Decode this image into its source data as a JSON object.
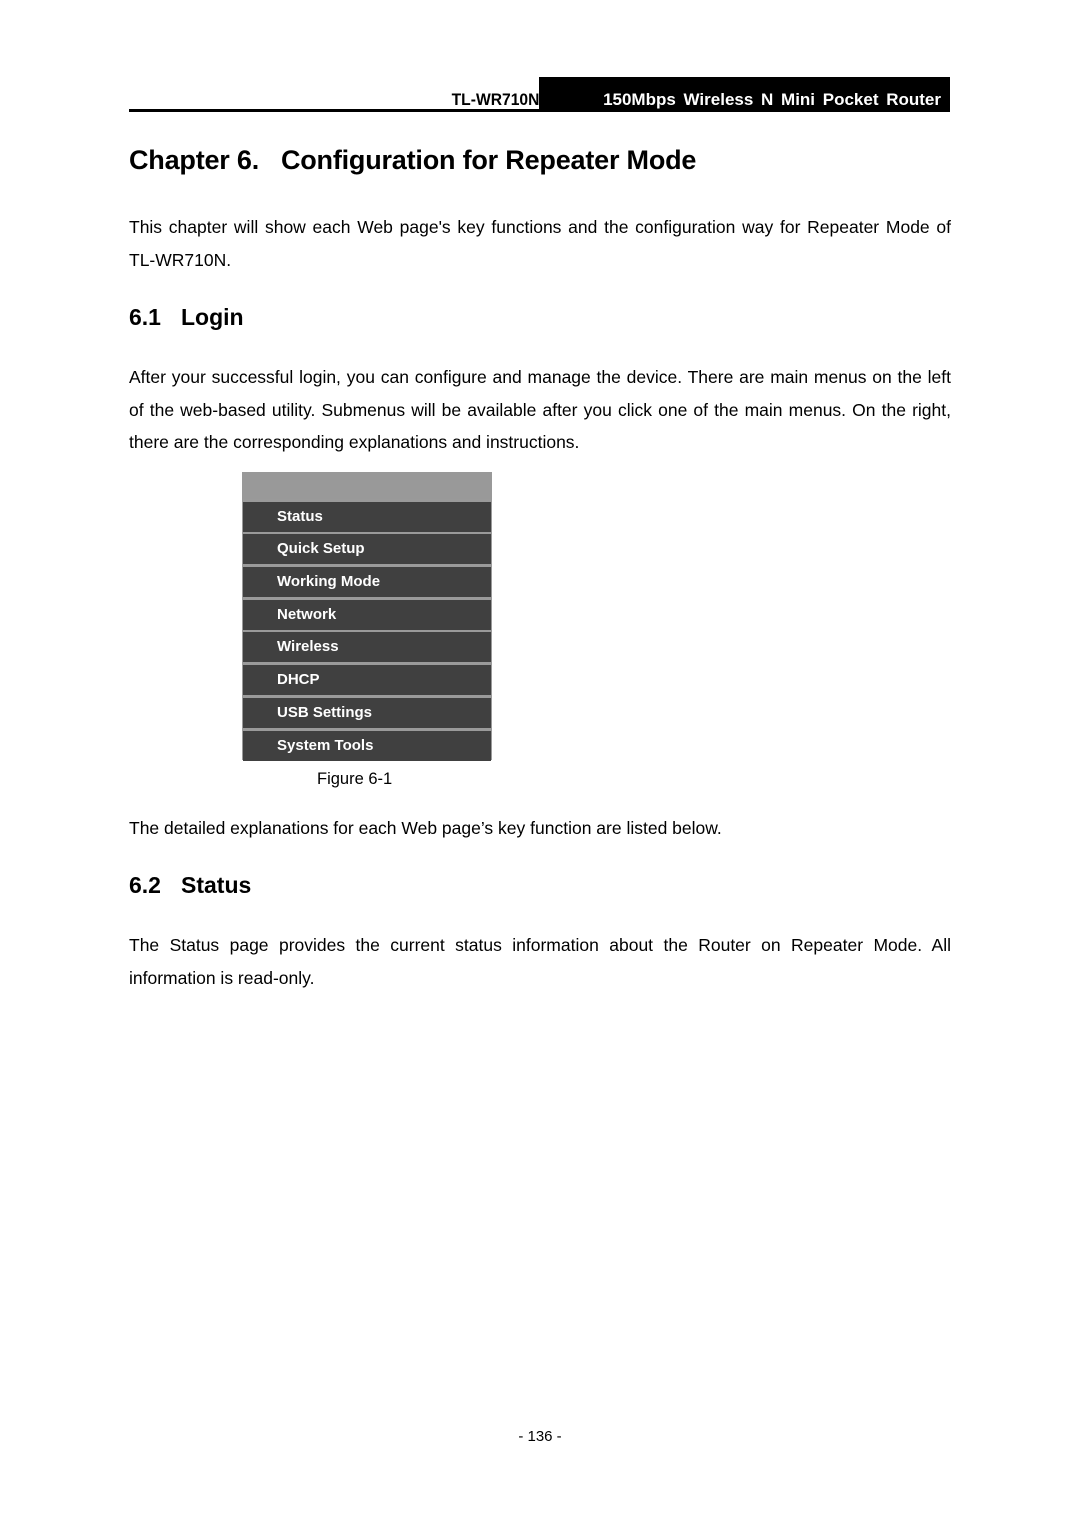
{
  "header": {
    "model": "TL-WR710N",
    "product": "150Mbps Wireless N Mini Pocket Router"
  },
  "chapter": {
    "title": "Chapter 6.   Configuration for Repeater Mode",
    "intro": "This chapter will show each Web page's key functions and the configuration way for Repeater Mode of TL-WR710N."
  },
  "sections": [
    {
      "number": "6.1",
      "title": "Login",
      "body": "After your successful login, you can configure and manage the device. There are main menus on the left of the web-based utility. Submenus will be available after you click one of the main menus. On the right, there are the corresponding explanations and instructions."
    },
    {
      "number": "6.2",
      "title": "Status",
      "body": "The Status page provides the current status information about the Router on Repeater Mode. All information is read-only."
    }
  ],
  "figure": {
    "menu_items": [
      {
        "label": "Status"
      },
      {
        "label": "Quick Setup"
      },
      {
        "label": "Working Mode"
      },
      {
        "label": "Network"
      },
      {
        "label": "Wireless"
      },
      {
        "label": "DHCP"
      },
      {
        "label": "USB Settings"
      },
      {
        "label": "System Tools"
      }
    ],
    "caption": "Figure 6-1"
  },
  "after_figure_text": "The detailed explanations for each Web page’s key function are listed below.",
  "footer": {
    "page_number": "- 136 -"
  },
  "colors": {
    "menu_background": "#404040",
    "menu_header": "#999999",
    "menu_text": "#ffffff"
  }
}
